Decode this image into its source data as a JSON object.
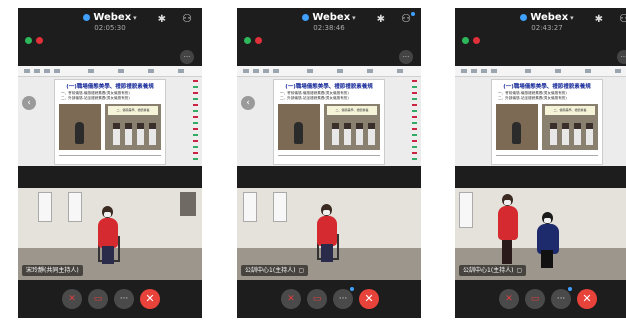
{
  "app": {
    "name": "Webex",
    "icons": {
      "bluetooth": "✱",
      "participants": "⚇",
      "chat": "···",
      "back": "‹",
      "mic_muted": "✕",
      "video_off": "▭",
      "more": "···",
      "end": "✕"
    }
  },
  "colors": {
    "background": "#1d1d1d",
    "end_button": "#e8433b",
    "accent": "#3fa0ff",
    "recording_green": "#2eb85c",
    "recording_red": "#e0303a"
  },
  "slide": {
    "title": "(一)職場儀態美學、禮節禮貌素養規",
    "line1": "一、會前儀態-儀態禮貌素養(男女儀態有別)",
    "line2": "二、外部儀態-站坐禮貌素養(男女儀態有別)",
    "photo_caption": "二、儀態美學、禮節素養"
  },
  "phones": [
    {
      "timer": "02:05:30",
      "presenter": "宋玲靜(共同主持人)"
    },
    {
      "timer": "02:38:46",
      "presenter": "公訓中心1(主持人)"
    },
    {
      "timer": "02:43:27",
      "presenter": "公訓中心1(主持人)"
    }
  ]
}
